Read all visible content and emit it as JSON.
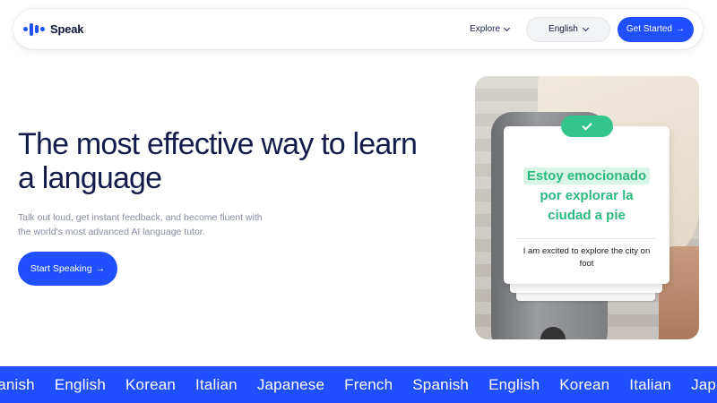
{
  "nav": {
    "logo_text": "Speak",
    "explore_label": "Explore",
    "language_label": "English",
    "cta_label": "Get Started",
    "cta_arrow": "→"
  },
  "hero": {
    "title": "The most effective way to learn a language",
    "subtitle": "Talk out loud, get instant feedback, and become fluent with the world's most advanced AI language tutor.",
    "cta_label": "Start Speaking",
    "cta_arrow": "→"
  },
  "card": {
    "phrase_line1": "Estoy emocionado",
    "phrase_line2": "por explorar la",
    "phrase_line3": "ciudad a pie",
    "translation": "I am excited to explore the city on foot"
  },
  "marquee": {
    "languages": [
      "Spanish",
      "English",
      "Korean",
      "Italian",
      "Japanese",
      "French",
      "Spanish",
      "English",
      "Korean",
      "Italian",
      "Japanese"
    ]
  },
  "colors": {
    "brand_blue": "#1f4fff",
    "success_green": "#33c58d",
    "heading_navy": "#131b4a"
  }
}
